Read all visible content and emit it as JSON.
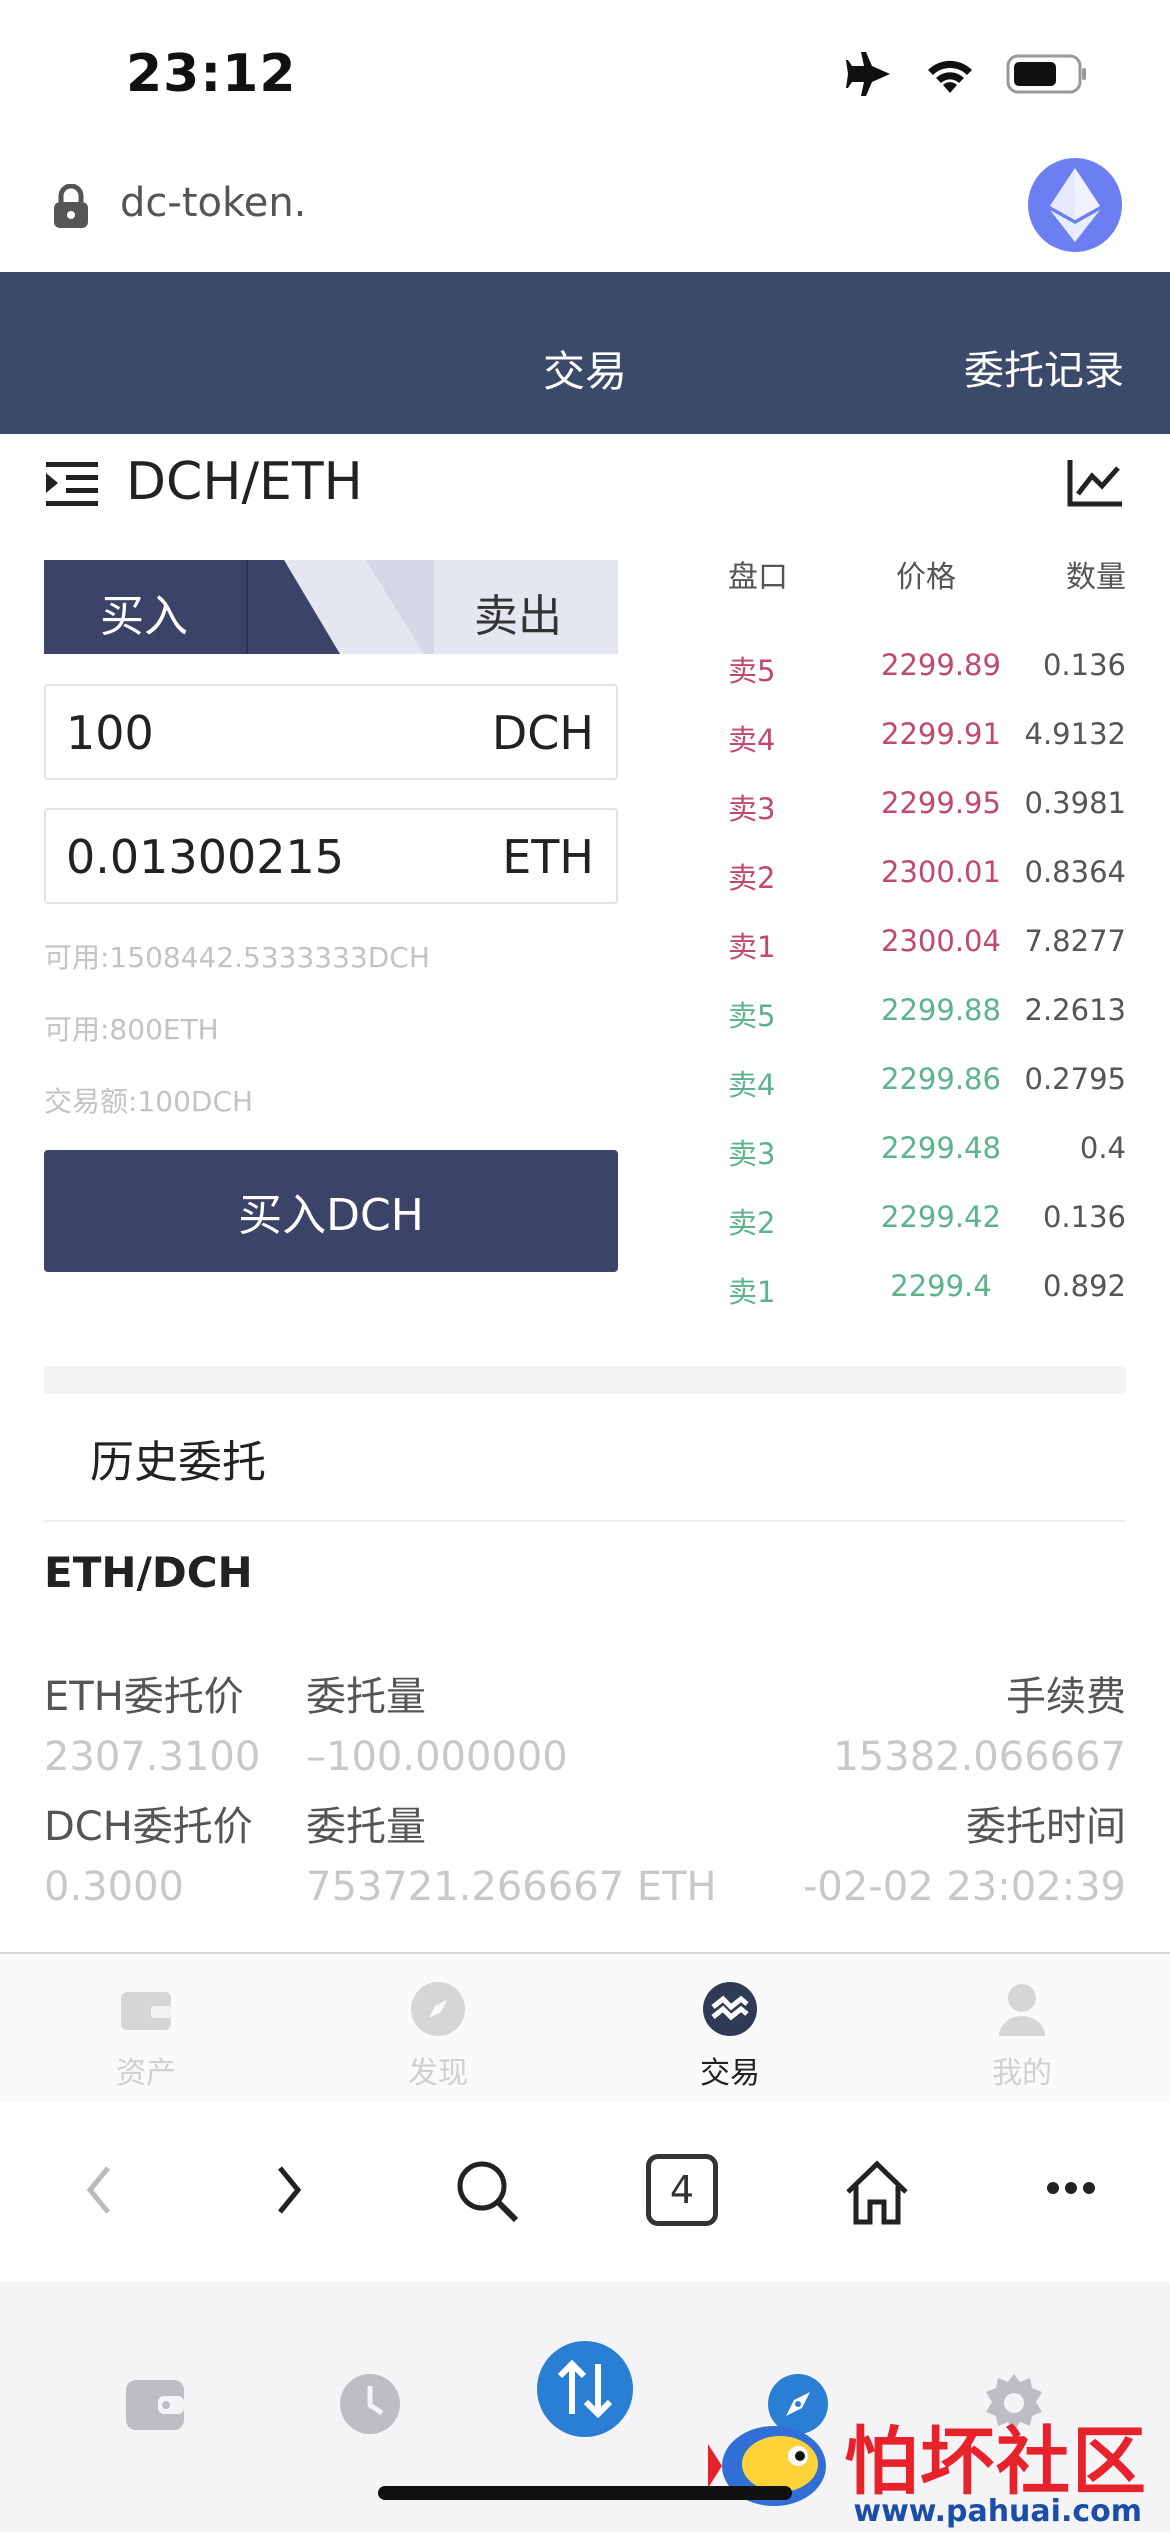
{
  "status": {
    "time": "23:12"
  },
  "browser": {
    "url": "dc-token."
  },
  "header": {
    "trade_tab": "交易",
    "records_tab": "委托记录"
  },
  "pair": "DCH/ETH",
  "form": {
    "buy_tab": "买入",
    "sell_tab": "卖出",
    "amount_value": "100",
    "amount_unit": "DCH",
    "price_value": "0.01300215",
    "price_unit": "ETH",
    "available_dch": "可用:1508442.5333333DCH",
    "available_eth": "可用:800ETH",
    "trade_amount": "交易额:100DCH",
    "submit_label": "买入DCH"
  },
  "orderbook": {
    "headers": [
      "盘口",
      "价格",
      "数量"
    ],
    "rows": [
      {
        "label": "卖5",
        "price": "2299.89",
        "qty": "0.136"
      },
      {
        "label": "卖4",
        "price": "2299.91",
        "qty": "4.9132"
      },
      {
        "label": "卖3",
        "price": "2299.95",
        "qty": "0.3981"
      },
      {
        "label": "卖2",
        "price": "2300.01",
        "qty": "0.8364"
      },
      {
        "label": "卖1",
        "price": "2300.04",
        "qty": "7.8277"
      },
      {
        "label": "卖5",
        "price": "2299.88",
        "qty": "2.2613"
      },
      {
        "label": "卖4",
        "price": "2299.86",
        "qty": "0.2795"
      },
      {
        "label": "卖3",
        "price": "2299.48",
        "qty": "0.4"
      },
      {
        "label": "卖2",
        "price": "2299.42",
        "qty": "0.136"
      },
      {
        "label": "卖1",
        "price": "2299.4",
        "qty": "0.892"
      }
    ],
    "ask_color": "#c14a6a",
    "bid_color": "#5bb48a"
  },
  "history": {
    "title": "历史委托",
    "order_pair": "ETH/DCH",
    "eth_price_label": "ETH委托价",
    "amount_label_1": "委托量",
    "fee_label": "手续费",
    "eth_price_value": "2307.3100",
    "amount_value_1": "–100.000000",
    "fee_value": "15382.066667",
    "dch_price_label": "DCH委托价",
    "amount_label_2": "委托量",
    "time_label": "委托时间",
    "dch_price_value": "0.3000",
    "amount_value_2": "753721.266667 ETH",
    "time_value": "-02-02 23:02:39"
  },
  "appnav": {
    "items": [
      {
        "label": "资产",
        "icon": "wallet-icon"
      },
      {
        "label": "发现",
        "icon": "compass-icon"
      },
      {
        "label": "交易",
        "icon": "trade-icon"
      },
      {
        "label": "我的",
        "icon": "user-icon"
      }
    ]
  },
  "browserbar": {
    "tab_count": "4"
  },
  "watermark": {
    "text": "怕坏社区",
    "url": "www.pahuai.com"
  }
}
